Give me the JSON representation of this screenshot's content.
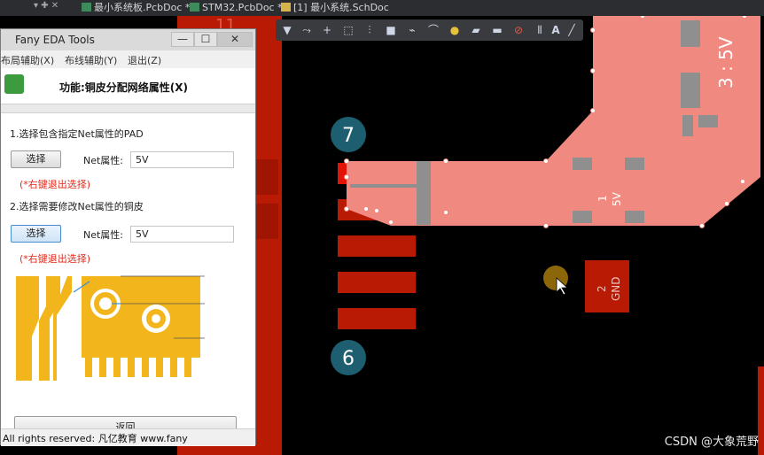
{
  "tabs": [
    {
      "label": "最小系统板.PcbDoc *",
      "icon": "pcb-file-icon"
    },
    {
      "label": "STM32.PcbDoc *",
      "icon": "pcb-file-icon"
    },
    {
      "label": "[1] 最小系统.SchDoc",
      "icon": "schematic-file-icon"
    }
  ],
  "pcb": {
    "pad_7_label": "7",
    "pad_6_label": "6",
    "pad_11_label": "11",
    "copper_pour_net": "3 : 5V",
    "pad1_label": "1",
    "pad1_net": "5V",
    "pad2_label": "2",
    "pad2_net": "GND",
    "colors": {
      "copper_top": "#b81a04",
      "copper_selected": "#f08a80",
      "pad_gray": "#8f8f8f",
      "marker": "#1d5f70"
    }
  },
  "dialog": {
    "window_title": "Fany EDA Tools",
    "minimize": "—",
    "maximize": "☐",
    "close": "✕",
    "menu": [
      "布局辅助(X)",
      "布线辅助(Y)",
      "退出(Z)"
    ],
    "function_title": "功能:铜皮分配网络属性(X)",
    "step1_label": "1.选择包含指定Net属性的PAD",
    "step1_button": "选择",
    "step1_net_label": "Net属性:",
    "step1_net_value": "5V",
    "step1_hint": "(*右键退出选择)",
    "step2_label": "2.选择需要修改Net属性的铜皮",
    "step2_button": "选择",
    "step2_net_label": "Net属性:",
    "step2_net_value": "5V",
    "step2_hint": "(*右键退出选择)",
    "back_button": "返回",
    "status": "All rights reserved: 凡亿教育 www.fany"
  },
  "watermark": "CSDN @大象荒野"
}
